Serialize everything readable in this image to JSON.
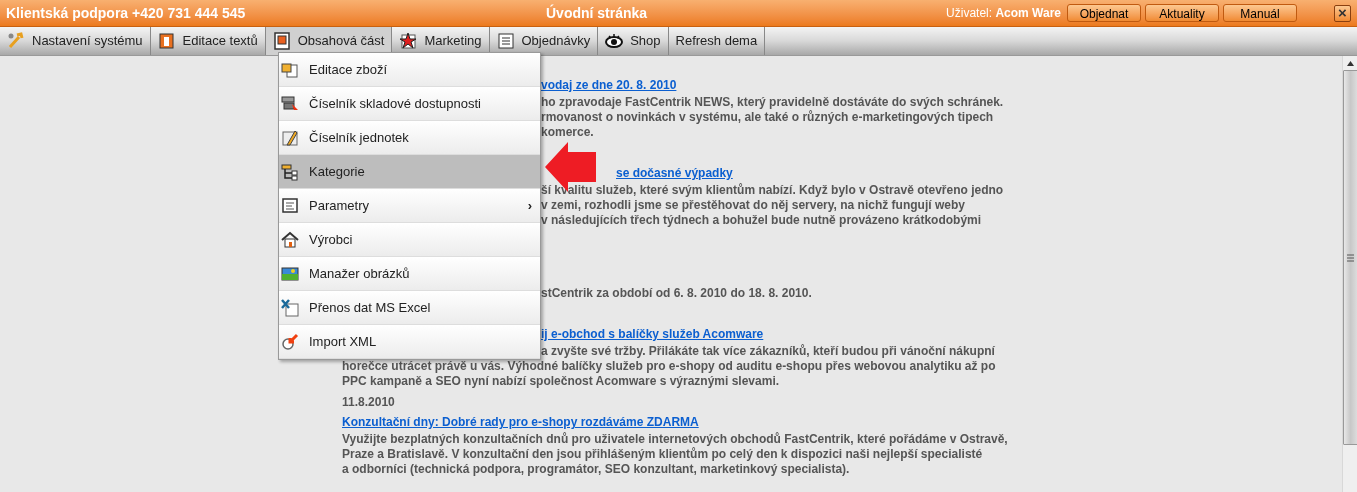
{
  "header": {
    "support": "Klientská podpora +420 731 444 545",
    "title": "Úvodní stránka",
    "user_label": "Uživatel:",
    "user_name": "Acom Ware",
    "buttons": [
      "Objednat",
      "Aktuality",
      "Manuál"
    ],
    "close": "×"
  },
  "menu_bar": [
    {
      "label": "Nastavení systému",
      "open": false
    },
    {
      "label": "Editace textů",
      "open": false
    },
    {
      "label": "Obsahová část",
      "open": true
    },
    {
      "label": "Marketing",
      "open": false
    },
    {
      "label": "Objednávky",
      "open": false
    },
    {
      "label": "Shop",
      "open": false
    },
    {
      "label": "Refresh dema",
      "open": false
    }
  ],
  "dropdown": [
    {
      "label": "Editace zboží",
      "selected": false
    },
    {
      "label": "Číselník skladové dostupnosti",
      "selected": false
    },
    {
      "label": "Číselník jednotek",
      "selected": false
    },
    {
      "label": "Kategorie",
      "selected": true
    },
    {
      "label": "Parametry",
      "selected": false,
      "arrow": "›"
    },
    {
      "label": "Výrobci",
      "selected": false
    },
    {
      "label": "Manažer obrázků",
      "selected": false
    },
    {
      "label": "Přenos dat MS Excel",
      "selected": false
    },
    {
      "label": "Import XML",
      "selected": false
    }
  ],
  "news": [
    {
      "title": "vodaj ze dne 20. 8. 2010",
      "lines": [
        "ho zpravodaje FastCentrik NEWS, který pravidelně dostáváte do svých schránek.",
        "rmovanost o novinkách v systému, ale také o různých e-marketingových tipech",
        "komerce."
      ]
    },
    {
      "title": "se dočasné výpadky",
      "lines": [
        "ší kvalitu služeb, které svým klientům nabízí. Když bylo v Ostravě otevřeno jedno",
        "v zemi, rozhodli jsme se přestěhovat do něj servery, na nichž fungují weby",
        "v následujících třech týdnech a bohužel bude nutně provázeno krátkodobými"
      ]
    },
    {
      "lines": [
        "stCentrik za období od 6. 8. 2010 do 18. 8. 2010."
      ]
    },
    {
      "title": "ij e-obchod s balíčky služeb Acomware",
      "lines": [
        "a zvyšte své tržby. Přilákáte tak více zákazníků, kteří budou při vánoční nákupní",
        "horečce utrácet právě u vás. Výhodné balíčky služeb pro e-shopy od auditu e-shopu přes webovou analytiku až po",
        "PPC kampaně a SEO nyní nabízí společnost Acomware s výraznými slevami."
      ]
    },
    {
      "date": "11.8.2010",
      "title": "Konzultační dny: Dobré rady pro e-shopy rozdáváme ZDARMA",
      "lines": [
        "Využijte bezplatných konzultačních dnů pro uživatele internetových obchodů FastCentrik, které pořádáme v Ostravě,",
        "Praze a Bratislavě. V konzultační den jsou přihlášeným klientům po celý den k dispozici naši nejlepší specialisté",
        "a odborníci (technická podpora, programátor, SEO konzultant, marketinkový specialista)."
      ]
    }
  ]
}
